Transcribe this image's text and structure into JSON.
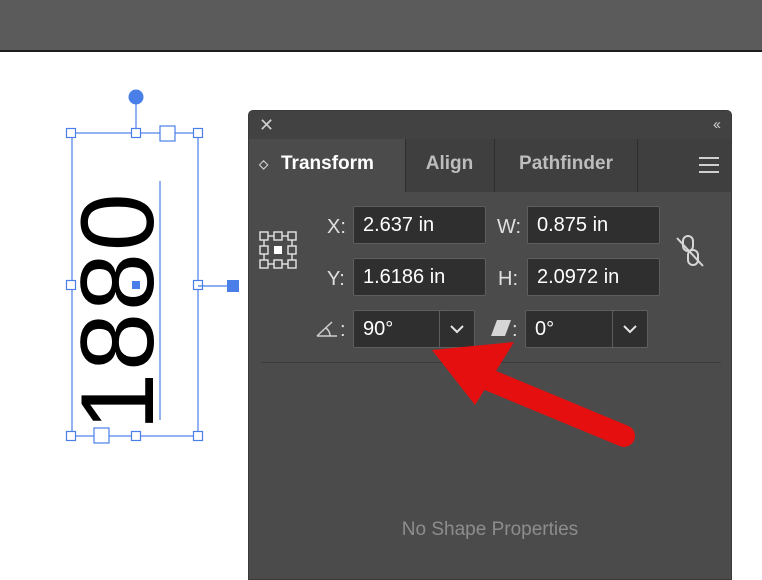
{
  "canvas": {
    "artwork_text": "1880"
  },
  "panel": {
    "tabs": [
      {
        "label": "Transform",
        "active": true
      },
      {
        "label": "Align",
        "active": false
      },
      {
        "label": "Pathfinder",
        "active": false
      }
    ],
    "fields": {
      "x": {
        "label": "X:",
        "value": "2.637 in"
      },
      "y": {
        "label": "Y:",
        "value": "1.6186 in"
      },
      "w": {
        "label": "W:",
        "value": "0.875 in"
      },
      "h": {
        "label": "H:",
        "value": "2.0972 in"
      },
      "rotate": {
        "label": ":",
        "value": "90°"
      },
      "shear": {
        "label": ":",
        "value": "0°"
      }
    },
    "empty_message": "No Shape Properties"
  },
  "icons": {
    "close": "close-icon",
    "collapse": "collapse-panel-icon",
    "menu": "panel-menu-icon",
    "reference_point": "reference-point-icon",
    "constrain": "constrain-proportions-icon",
    "rotate": "rotate-angle-icon",
    "shear": "shear-icon"
  },
  "colors": {
    "selection": "#4a7ee8",
    "panel_bg": "#4b4b4b",
    "field_bg": "#2f2f2f",
    "arrow": "#e50f0f"
  }
}
